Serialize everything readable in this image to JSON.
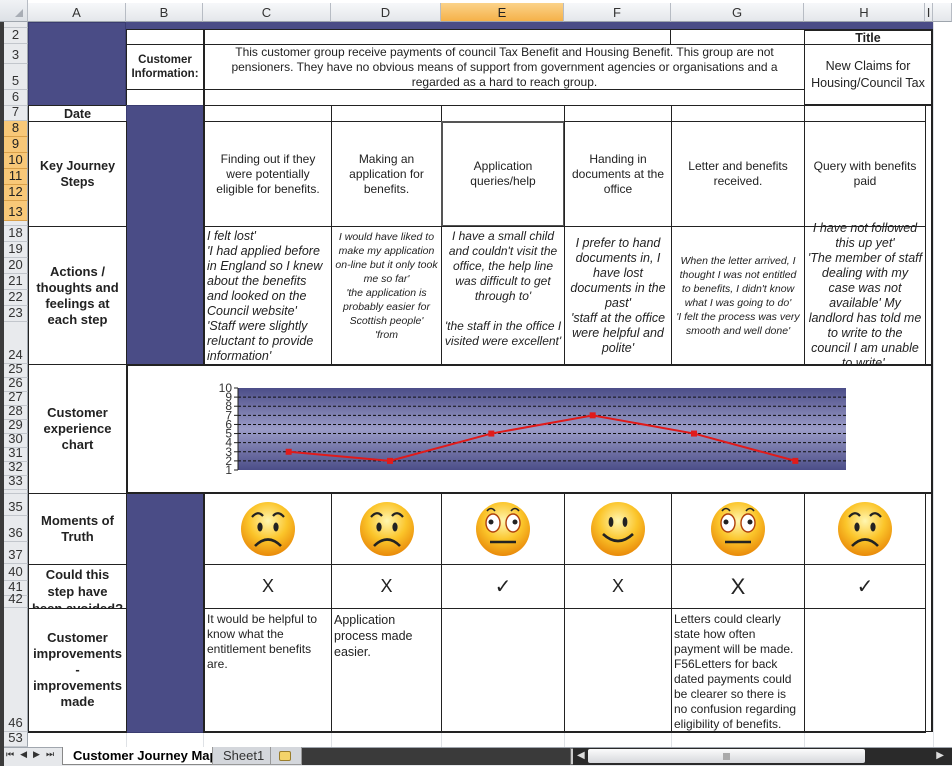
{
  "app": {
    "type": "spreadsheet"
  },
  "columns": [
    "A",
    "B",
    "C",
    "D",
    "E",
    "F",
    "G",
    "H",
    "I"
  ],
  "selected_column": "E",
  "rows": [
    "2",
    "3",
    "5",
    "6",
    "7",
    "8",
    "9",
    "10",
    "11",
    "12",
    "13",
    "18",
    "19",
    "20",
    "21",
    "22",
    "23",
    "24",
    "25",
    "26",
    "27",
    "28",
    "29",
    "30",
    "31",
    "32",
    "33",
    "35",
    "36",
    "37",
    "40",
    "41",
    "42",
    "46",
    "53"
  ],
  "header": {
    "title_label": "Title",
    "title_value": "New Claims for Housing/Council Tax",
    "customer_info_label": "Customer Information:",
    "customer_info_text": "This customer group receive payments of council Tax Benefit and Housing Benefit.  This group are not pensioners. They have no obvious means of support from government agencies or organisations and a regarded as a hard to reach group."
  },
  "row_labels": {
    "date": "Date",
    "steps": "Key Journey Steps",
    "actions": "Actions / thoughts and feelings at each step",
    "chart": "Customer experience chart",
    "moments": "Moments of Truth",
    "avoided": "Could this step have been avoided?",
    "improvements": "Customer improvements - improvements made"
  },
  "steps": [
    {
      "name": "Finding out if they were potentially eligible for benefits.",
      "quote": "I felt lost'\n'I had applied before in England so I knew about the benefits and looked on the Council website'\n'Staff were slightly reluctant to provide information'",
      "mood": "sad",
      "avoided": "X",
      "improvement": "It would be helpful to know what the entitlement benefits are."
    },
    {
      "name": "Making an application for benefits.",
      "quote": "I would have liked to make my application on-line but it only took me so far'\n'the application is probably easier for Scottish people'\n'from",
      "mood": "sad",
      "avoided": "X",
      "improvement": "Application process made easier."
    },
    {
      "name": "Application queries/help",
      "quote": "I have a small child and couldn't visit the office, the help line was difficult to get through to'\n\n'the staff in the office I visited were excellent'",
      "mood": "neutral",
      "avoided": "✓",
      "improvement": ""
    },
    {
      "name": "Handing in documents at the office",
      "quote": "I prefer to hand documents in, I have lost documents in the past'\n'staff at the office were helpful and polite'",
      "mood": "happy",
      "avoided": "X",
      "improvement": ""
    },
    {
      "name": "Letter and benefits received.",
      "quote": "When the letter arrived, I thought I was not entitled to benefits, I didn't know what I was going to do'\n'I felt the process was very smooth and well done'",
      "mood": "neutral",
      "avoided": "X",
      "improvement": "Letters could clearly state how often payment will be made.\nF56Letters for back dated payments could be clearer so there is no confusion regarding eligibility of benefits."
    },
    {
      "name": "Query with benefits paid",
      "quote": "I have not followed this up yet'\n'The member of staff dealing with my case was not available'  My landlord has told me to write to the council I am unable to write'.",
      "mood": "sad",
      "avoided": "✓",
      "improvement": ""
    }
  ],
  "chart_data": {
    "type": "line",
    "title": "",
    "xlabel": "",
    "ylabel": "",
    "categories": [
      "Finding out if they were potentially eligible for benefits.",
      "Making an application for benefits.",
      "Application queries/help",
      "Handing in documents at the office",
      "Letter and benefits received.",
      "Query with benefits paid"
    ],
    "series": [
      {
        "name": "Customer experience",
        "values": [
          3,
          2,
          5,
          7,
          5,
          2
        ],
        "color": "#e01b1b"
      }
    ],
    "yticks": [
      "1",
      "2",
      "3",
      "4",
      "5",
      "6",
      "7",
      "8",
      "9",
      "10"
    ],
    "ylim": [
      1,
      10
    ],
    "grid": true,
    "legend": "none",
    "plot_bg": "#4a4c86"
  },
  "colors": {
    "navy": "#4a4c86",
    "selected_header": "#f5b149",
    "line": "#e01b1b"
  },
  "tabs": {
    "active": "Customer Journey Map",
    "other": "Sheet1"
  },
  "icons": {
    "nav_first": "⏮",
    "nav_prev": "◀",
    "nav_next": "▶",
    "nav_last": "⏭"
  }
}
